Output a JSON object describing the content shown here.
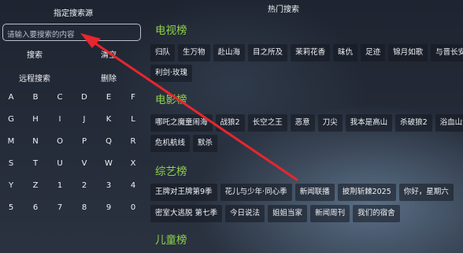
{
  "left_panel": {
    "title": "指定搜索源",
    "search_placeholder": "请输入要搜索的内容",
    "search_label": "搜索",
    "clear_label": "清空",
    "remote_search_label": "远程搜索",
    "delete_label": "删除",
    "keys": [
      "A",
      "B",
      "C",
      "D",
      "E",
      "F",
      "G",
      "H",
      "I",
      "J",
      "K",
      "L",
      "M",
      "N",
      "O",
      "P",
      "Q",
      "R",
      "S",
      "T",
      "U",
      "V",
      "W",
      "X",
      "Y",
      "Z",
      "1",
      "2",
      "3",
      "4",
      "5",
      "6",
      "7",
      "8",
      "9",
      "0"
    ]
  },
  "hot_search": {
    "title": "热门搜索",
    "sections": [
      {
        "title": "电视榜",
        "rows": [
          [
            "归队",
            "生万物",
            "赴山海",
            "目之所及",
            "茉莉花香",
            "昧仇",
            "足迹",
            "锦月如歌",
            "与晋长安"
          ],
          [
            "利剑·玫瑰"
          ]
        ]
      },
      {
        "title": "电影榜",
        "rows": [
          [
            "哪吒之魔童闹海",
            "战狼2",
            "长空之王",
            "恶意",
            "刀尖",
            "我本是高山",
            "杀破狼2",
            "浴血山河"
          ],
          [
            "危机航线",
            "默杀"
          ]
        ]
      },
      {
        "title": "综艺榜",
        "rows": [
          [
            "王牌对王牌第9季",
            "花儿与少年·同心季",
            "新闻联播",
            "披荆斩棘2025",
            "你好，星期六"
          ],
          [
            "密室大逃脱 第七季",
            "今日说法",
            "姐姐当家",
            "新闻周刊",
            "我们的宿舍"
          ]
        ]
      },
      {
        "title": "儿童榜",
        "rows": []
      }
    ]
  },
  "colors": {
    "section_title": "#8fd14a",
    "arrow": "#e8262d"
  }
}
